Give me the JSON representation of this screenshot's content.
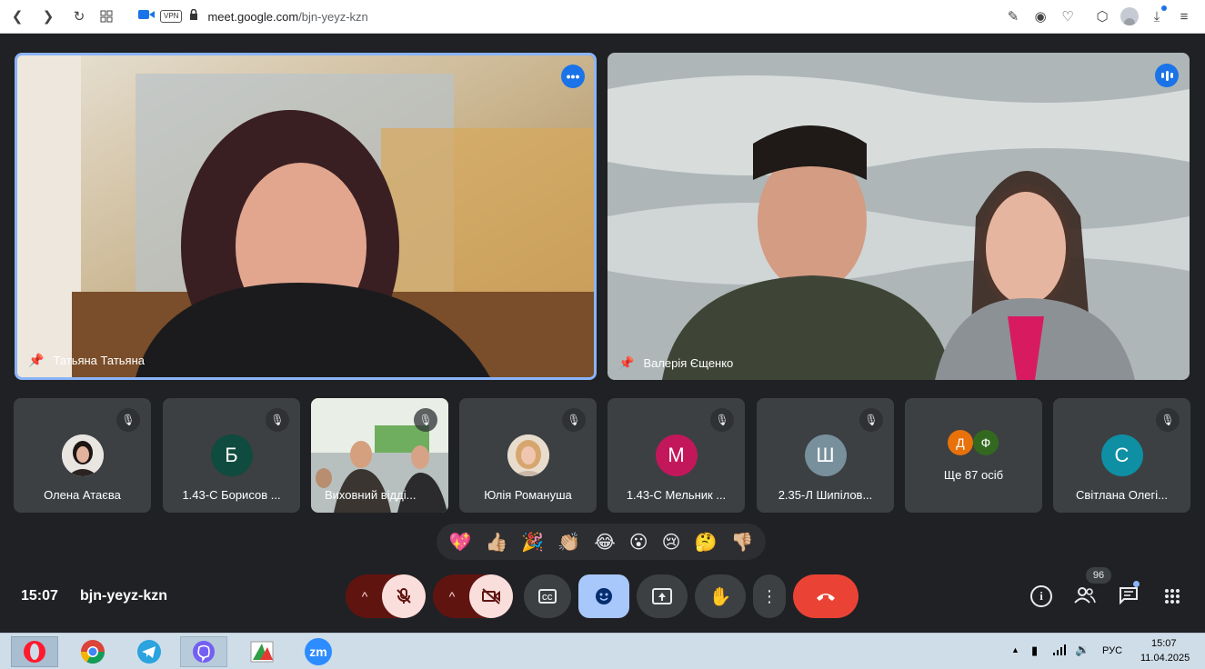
{
  "browser": {
    "vpn_label": "VPN",
    "url_domain": "meet.google.com",
    "url_path": "/bjn-yeyz-kzn"
  },
  "pinned": [
    {
      "name": "Татьяна Татьяна"
    },
    {
      "name": "Валерія Єщенко"
    }
  ],
  "participants": [
    {
      "name": "Олена Атаєва",
      "initial": "",
      "color": "#ffffff"
    },
    {
      "name": "1.43-С Борисов ...",
      "initial": "Б",
      "color": "#0f4b3e"
    },
    {
      "name": "Виховний відді...",
      "initial": "",
      "color": "#000000"
    },
    {
      "name": "Юлія Романуша",
      "initial": "",
      "color": "#ffffff"
    },
    {
      "name": "1.43-С Мельник ...",
      "initial": "М",
      "color": "#c2185b"
    },
    {
      "name": "2.35-Л Шипілов...",
      "initial": "Ш",
      "color": "#78909c"
    },
    {
      "name": "Ще 87 осіб",
      "initial": "",
      "color": ""
    },
    {
      "name": "Світлана Олегі...",
      "initial": "С",
      "color": "#0e8fa3"
    }
  ],
  "more_people": {
    "a": "Д",
    "b": "Ф",
    "label": "Ще 87 осіб"
  },
  "reactions": [
    "💖",
    "👍🏼",
    "🎉",
    "👏🏼",
    "😂",
    "😮",
    "😢",
    "🤔",
    "👎🏼"
  ],
  "meeting": {
    "time": "15:07",
    "code": "bjn-yeyz-kzn",
    "participants_count": "96"
  },
  "taskbar": {
    "lang": "РУС",
    "clock_time": "15:07",
    "clock_date": "11.04.2025",
    "zoom_label": "zm"
  },
  "colors": {
    "accent": "#8ab4f8",
    "hangup": "#ea4335",
    "mic_off_bg": "#f9dedc",
    "chevron_bg": "#601410"
  }
}
